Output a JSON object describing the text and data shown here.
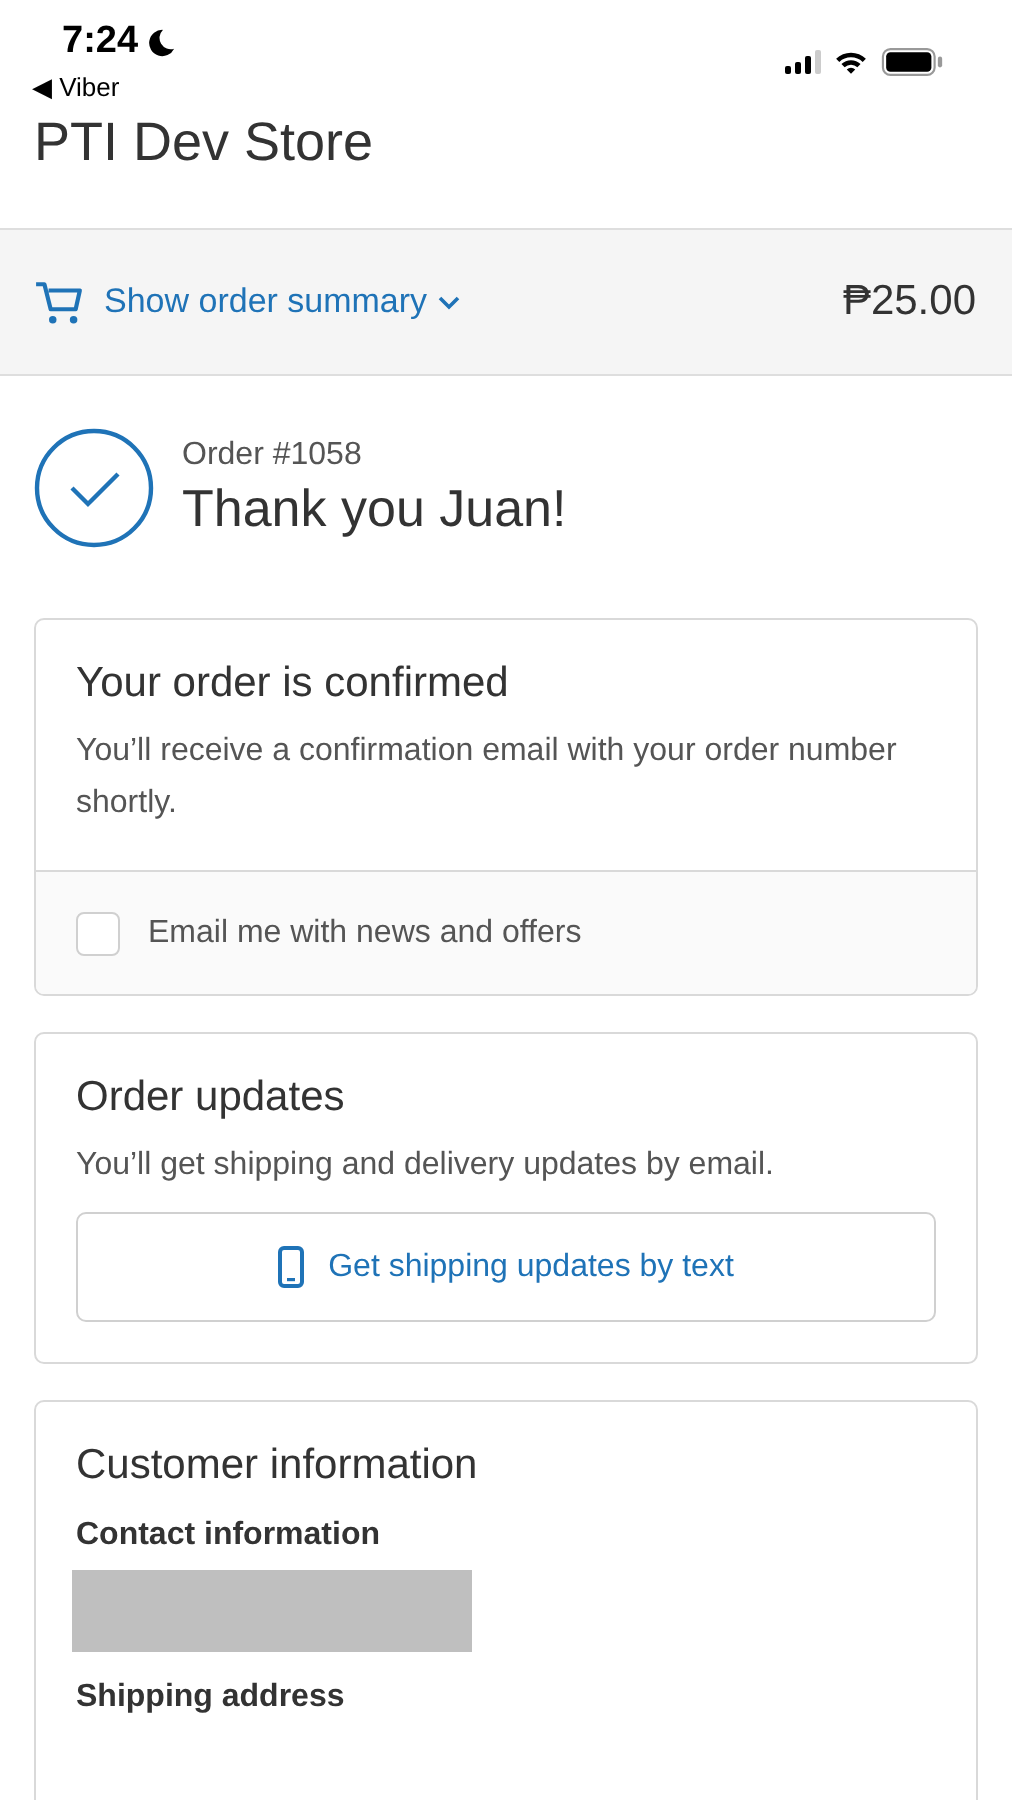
{
  "status_bar": {
    "time": "7:24",
    "back_link": "◀ Viber"
  },
  "header": {
    "store_name": "PTI Dev Store"
  },
  "summary_bar": {
    "label": "Show order summary",
    "total": "₱25.00"
  },
  "order": {
    "number": "Order #1058",
    "greeting": "Thank you Juan!"
  },
  "confirmation_card": {
    "title": "Your order is confirmed",
    "text": "You’ll receive a confirmation email with your order number shortly.",
    "newsletter": {
      "label": "Email me with news and offers",
      "checked": false
    }
  },
  "updates_card": {
    "title": "Order updates",
    "text": "You’ll get shipping and delivery updates by email.",
    "button": "Get shipping updates by text"
  },
  "customer_card": {
    "title": "Customer information",
    "sections": [
      {
        "heading": "Contact information",
        "redacted": true
      },
      {
        "heading": "Shipping address",
        "redacted": false
      }
    ]
  }
}
